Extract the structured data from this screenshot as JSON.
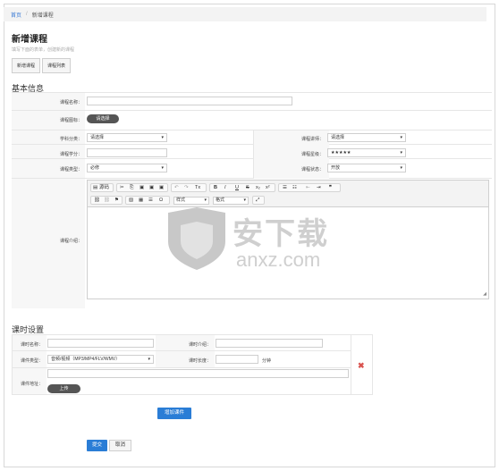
{
  "breadcrumb": {
    "home": "首页",
    "sep": "/",
    "current": "新增课程"
  },
  "page": {
    "title": "新增课程",
    "subtitle": "填写下面的表单，创建新的课程"
  },
  "tabs": [
    {
      "label": "新增课程"
    },
    {
      "label": "课程列表"
    }
  ],
  "basic": {
    "section_title": "基本信息",
    "course_name": {
      "label": "课程名称：",
      "value": ""
    },
    "course_icon": {
      "label": "课程图标：",
      "button": "请选择"
    },
    "subject": {
      "label": "学科分类：",
      "value": "请选择"
    },
    "teacher": {
      "label": "课程讲师：",
      "value": "请选择"
    },
    "credit": {
      "label": "课程学分：",
      "value": ""
    },
    "level": {
      "label": "课程星级：",
      "value": "★★★★★"
    },
    "type": {
      "label": "课程类型：",
      "value": "必修"
    },
    "status": {
      "label": "课程状态：",
      "value": "开放"
    },
    "intro": {
      "label": "课程介绍："
    }
  },
  "editor": {
    "source_label": "源码",
    "bold": "B",
    "italic": "I",
    "underline": "U",
    "strike": "S",
    "sub": "x₂",
    "sup": "x²",
    "omega": "Ω",
    "styles_placeholder": "样式",
    "format_placeholder": "格式",
    "quote": "❞"
  },
  "watermark": {
    "brand": "安下载",
    "domain": "anxz.com"
  },
  "lesson": {
    "section_title": "课时设置",
    "name": {
      "label": "课时名称：",
      "value": ""
    },
    "intro": {
      "label": "课时介绍：",
      "value": ""
    },
    "type": {
      "label": "课件类型：",
      "value": "音频/视频（MP3/MP4/FLV/WMV）"
    },
    "length": {
      "label": "课时长度：",
      "value": "",
      "unit": "分钟"
    },
    "address": {
      "label": "课件地址：",
      "value": "",
      "upload": "上传"
    },
    "add_button": "增加课件"
  },
  "actions": {
    "submit": "提交",
    "cancel": "取消"
  }
}
